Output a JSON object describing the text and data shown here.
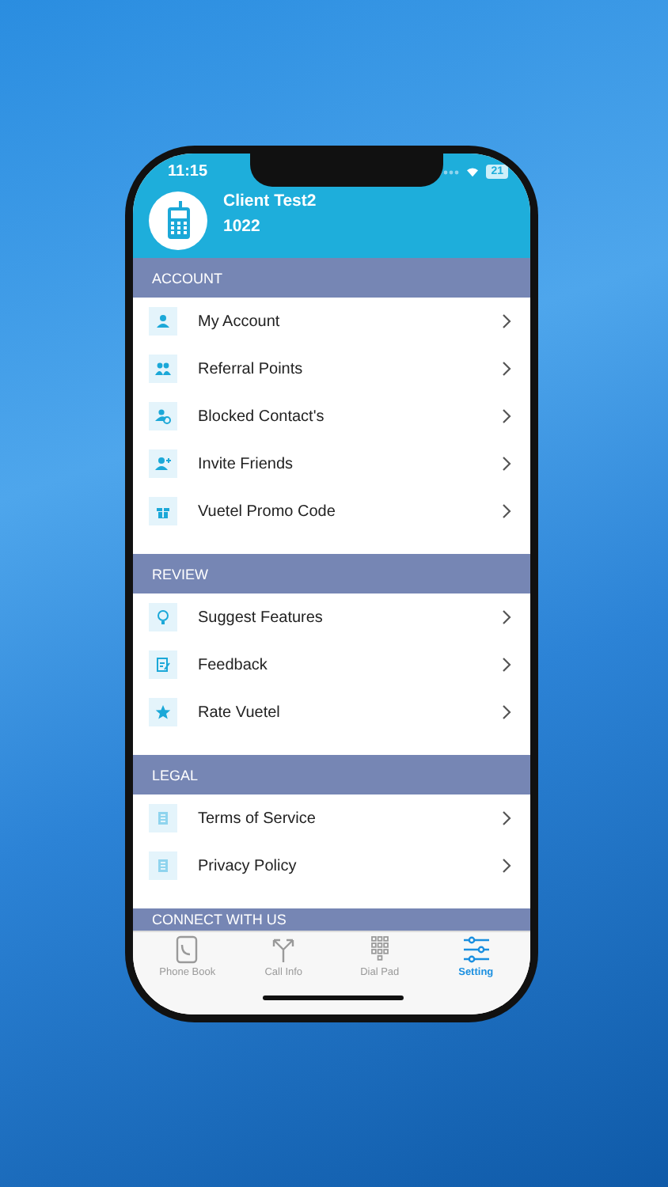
{
  "status_bar": {
    "time": "11:15",
    "battery": "21"
  },
  "profile": {
    "name": "Client Test2",
    "number": "1022"
  },
  "sections": [
    {
      "title": "ACCOUNT",
      "items": [
        {
          "label": "My Account"
        },
        {
          "label": "Referral Points"
        },
        {
          "label": "Blocked Contact's"
        },
        {
          "label": "Invite Friends"
        },
        {
          "label": "Vuetel Promo Code"
        }
      ]
    },
    {
      "title": "REVIEW",
      "items": [
        {
          "label": "Suggest Features"
        },
        {
          "label": "Feedback"
        },
        {
          "label": "Rate Vuetel"
        }
      ]
    },
    {
      "title": "LEGAL",
      "items": [
        {
          "label": "Terms of Service"
        },
        {
          "label": "Privacy Policy"
        }
      ]
    },
    {
      "title": "CONNECT WITH US"
    }
  ],
  "tabs": [
    {
      "label": "Phone Book",
      "selected": false
    },
    {
      "label": "Call Info",
      "selected": false
    },
    {
      "label": "Dial Pad",
      "selected": false
    },
    {
      "label": "Setting",
      "selected": true
    }
  ]
}
